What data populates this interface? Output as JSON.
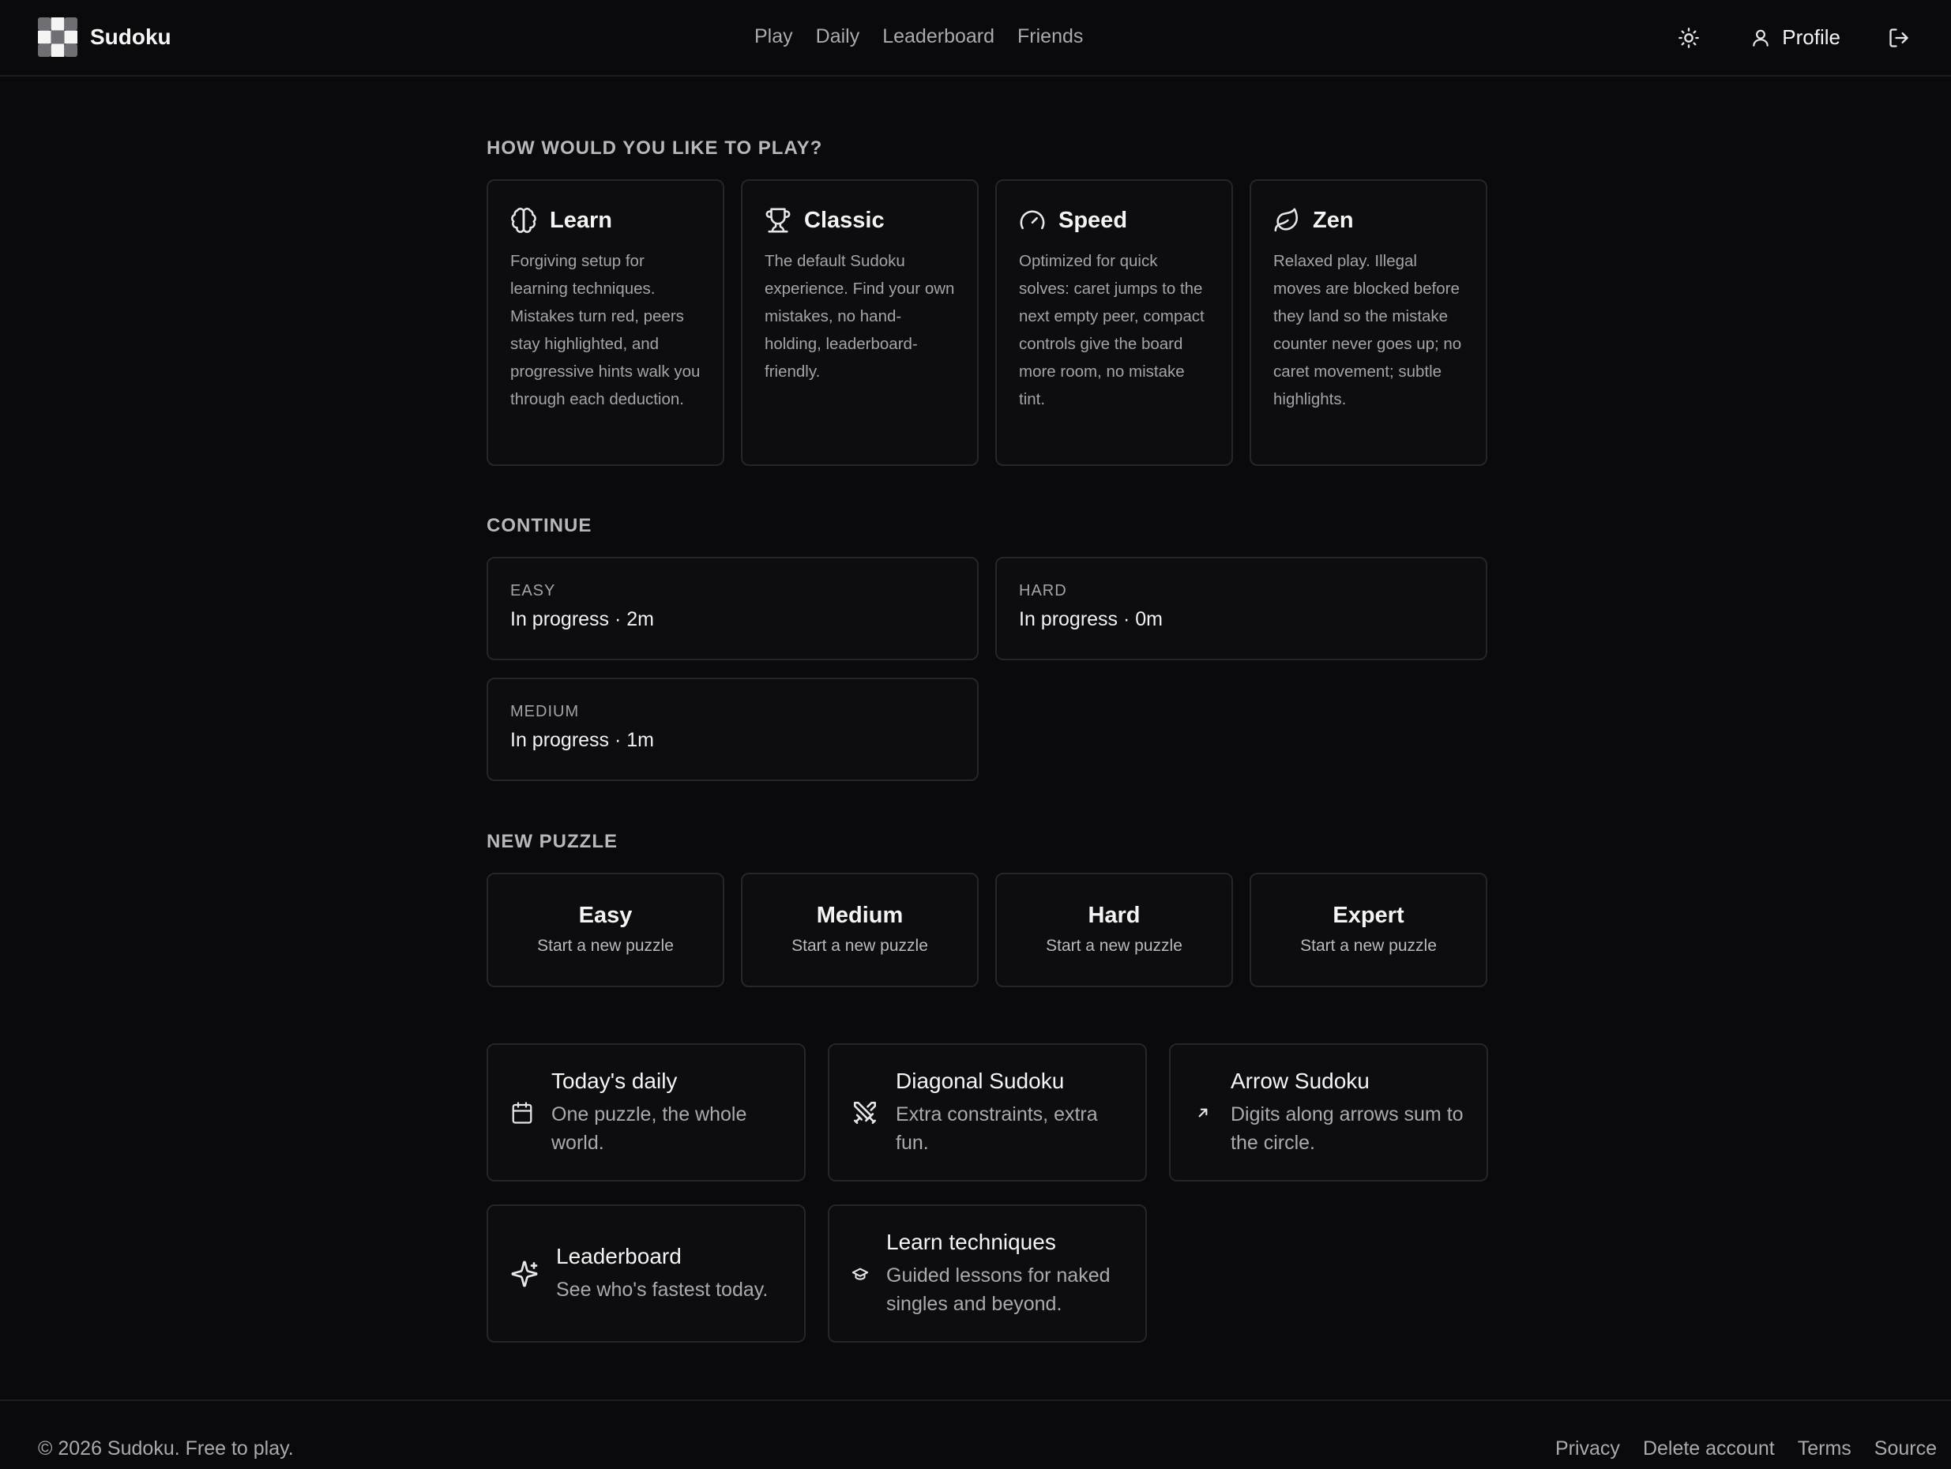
{
  "header": {
    "brand": "Sudoku",
    "nav": [
      "Play",
      "Daily",
      "Leaderboard",
      "Friends"
    ],
    "theme_icon": "sun-icon",
    "profile_label": "Profile",
    "logout_icon": "logout-icon"
  },
  "modes": {
    "title": "HOW WOULD YOU LIKE TO PLAY?",
    "items": [
      {
        "icon": "brain-icon",
        "title": "Learn",
        "description": "Forgiving setup for learning techniques. Mistakes turn red, peers stay highlighted, and progressive hints walk you through each deduction."
      },
      {
        "icon": "trophy-icon",
        "title": "Classic",
        "description": "The default Sudoku experience. Find your own mistakes, no hand-holding, leaderboard-friendly."
      },
      {
        "icon": "gauge-icon",
        "title": "Speed",
        "description": "Optimized for quick solves: caret jumps to the next empty peer, compact controls give the board more room, no mistake tint."
      },
      {
        "icon": "leaf-icon",
        "title": "Zen",
        "description": "Relaxed play. Illegal moves are blocked before they land so the mistake counter never goes up; no caret movement; subtle highlights."
      }
    ]
  },
  "continue": {
    "title": "CONTINUE",
    "items": [
      {
        "level": "EASY",
        "status": "In progress · 2m"
      },
      {
        "level": "HARD",
        "status": "In progress · 0m"
      },
      {
        "level": "MEDIUM",
        "status": "In progress · 1m"
      }
    ]
  },
  "new_puzzle": {
    "title": "NEW PUZZLE",
    "items": [
      {
        "title": "Easy",
        "subtitle": "Start a new puzzle"
      },
      {
        "title": "Medium",
        "subtitle": "Start a new puzzle"
      },
      {
        "title": "Hard",
        "subtitle": "Start a new puzzle"
      },
      {
        "title": "Expert",
        "subtitle": "Start a new puzzle"
      }
    ]
  },
  "features": [
    {
      "icon": "calendar-icon",
      "title": "Today's daily",
      "description": "One puzzle, the whole world."
    },
    {
      "icon": "swords-icon",
      "title": "Diagonal Sudoku",
      "description": "Extra constraints, extra fun."
    },
    {
      "icon": "arrow-up-right-icon",
      "title": "Arrow Sudoku",
      "description": "Digits along arrows sum to the circle."
    },
    {
      "icon": "sparkles-icon",
      "title": "Leaderboard",
      "description": "See who's fastest today."
    },
    {
      "icon": "graduation-cap-icon",
      "title": "Learn techniques",
      "description": "Guided lessons for naked singles and beyond."
    }
  ],
  "footer": {
    "copyright": "© 2026 Sudoku. Free to play.",
    "links": [
      "Privacy",
      "Delete account",
      "Terms",
      "Source"
    ]
  }
}
